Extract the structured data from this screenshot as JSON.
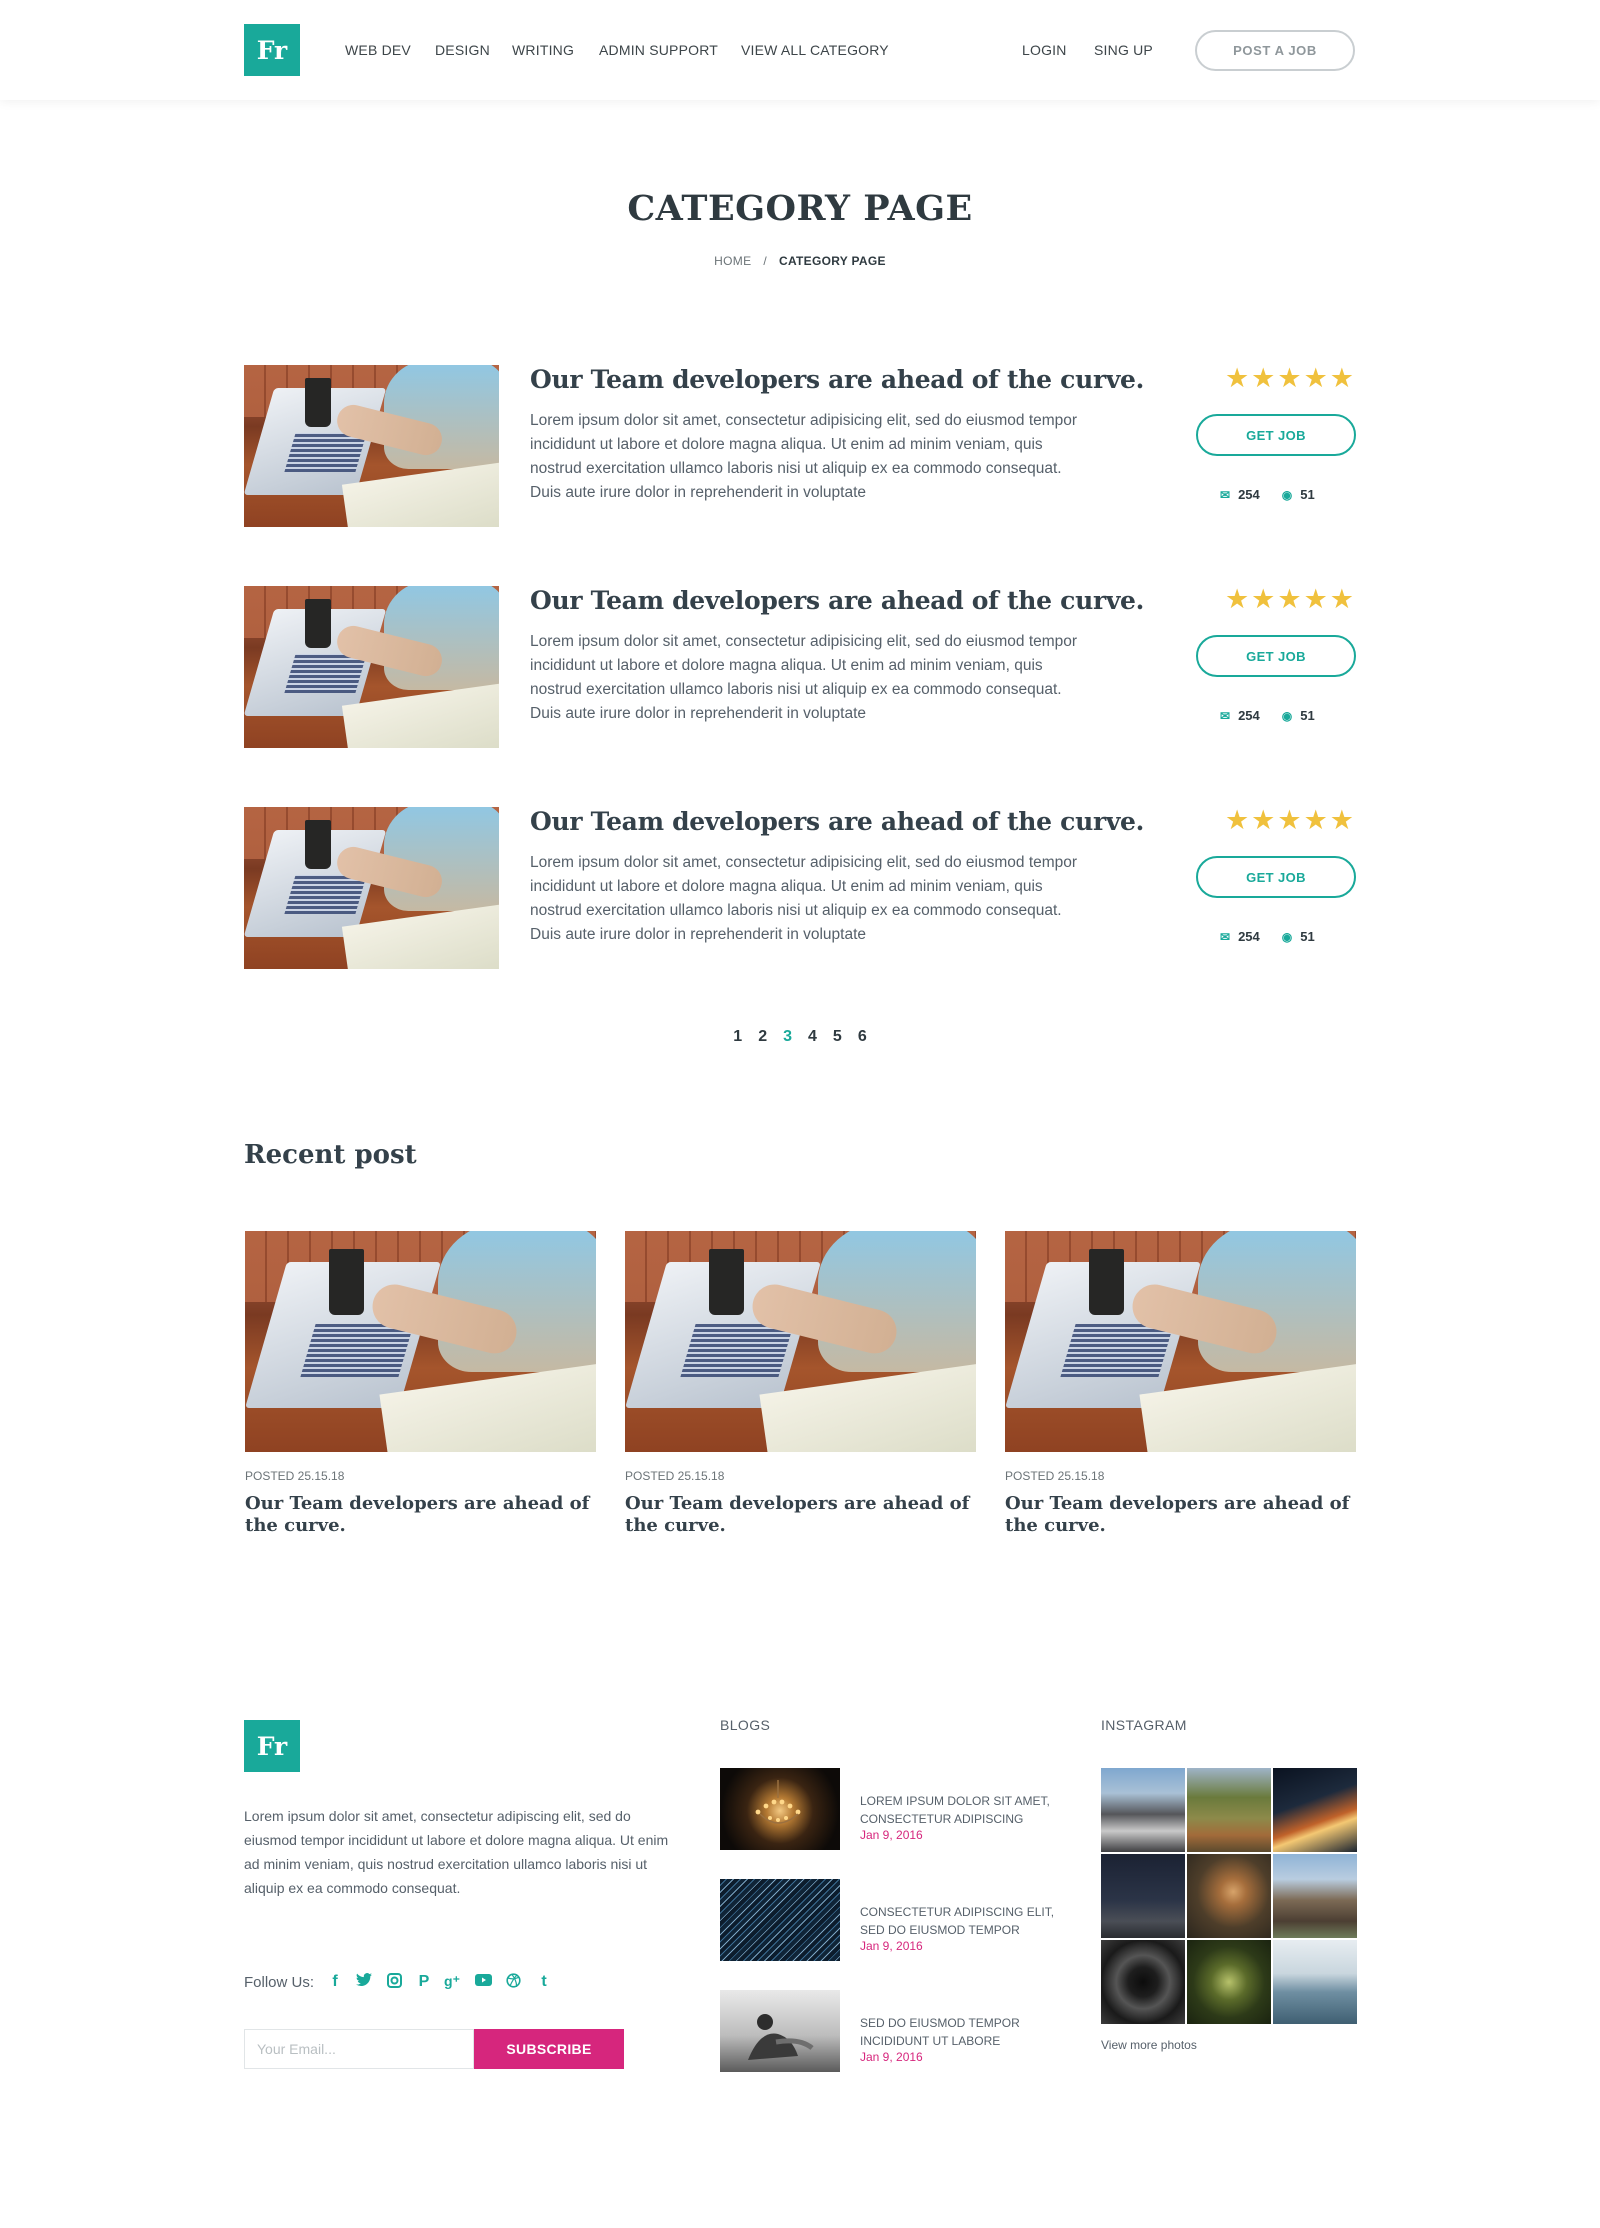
{
  "header": {
    "logo": "Fr",
    "nav": [
      "WEB DEV",
      "DESIGN",
      "WRITING",
      "ADMIN SUPPORT",
      "VIEW ALL CATEGORY"
    ],
    "login": "LOGIN",
    "signup": "SING UP",
    "post_job": "POST A JOB"
  },
  "hero": {
    "title": "CATEGORY PAGE",
    "breadcrumb": {
      "home": "HOME",
      "separator": "/",
      "current": "CATEGORY PAGE"
    }
  },
  "listings": [
    {
      "title": "Our Team developers are ahead of the curve.",
      "description": "Lorem ipsum dolor sit amet, consectetur adipisicing elit, sed do eiusmod tempor incididunt ut labore et dolore magna aliqua. Ut enim ad minim veniam, quis nostrud exercitation ullamco laboris nisi ut aliquip ex ea commodo consequat. Duis aute irure dolor in reprehenderit in voluptate",
      "rating": 5,
      "button": "GET JOB",
      "messages": "254",
      "views": "51"
    },
    {
      "title": "Our Team developers are ahead of the curve.",
      "description": "Lorem ipsum dolor sit amet, consectetur adipisicing elit, sed do eiusmod tempor incididunt ut labore et dolore magna aliqua. Ut enim ad minim veniam, quis nostrud exercitation ullamco laboris nisi ut aliquip ex ea commodo consequat. Duis aute irure dolor in reprehenderit in voluptate",
      "rating": 5,
      "button": "GET JOB",
      "messages": "254",
      "views": "51"
    },
    {
      "title": "Our Team developers are ahead of the curve.",
      "description": "Lorem ipsum dolor sit amet, consectetur adipisicing elit, sed do eiusmod tempor incididunt ut labore et dolore magna aliqua. Ut enim ad minim veniam, quis nostrud exercitation ullamco laboris nisi ut aliquip ex ea commodo consequat. Duis aute irure dolor in reprehenderit in voluptate",
      "rating": 5,
      "button": "GET JOB",
      "messages": "254",
      "views": "51"
    }
  ],
  "pagination": {
    "pages": [
      "1",
      "2",
      "3",
      "4",
      "5",
      "6"
    ],
    "current": "3"
  },
  "recent": {
    "title": "Recent post",
    "posts": [
      {
        "date": "POSTED 25.15.18",
        "title": "Our Team developers are ahead of the curve."
      },
      {
        "date": "POSTED 25.15.18",
        "title": "Our Team developers are ahead of the curve."
      },
      {
        "date": "POSTED 25.15.18",
        "title": "Our Team developers are ahead of the curve."
      }
    ]
  },
  "footer": {
    "logo": "Fr",
    "about": "Lorem ipsum dolor sit amet, consectetur adipiscing elit, sed do eiusmod tempor incididunt ut labore et dolore magna aliqua. Ut enim ad minim veniam, quis nostrud exercitation ullamco laboris nisi ut aliquip ex ea commodo consequat.",
    "follow": "Follow Us:",
    "social": [
      "facebook-icon",
      "twitter-icon",
      "instagram-icon",
      "pinterest-icon",
      "google-plus-icon",
      "youtube-icon",
      "dribbble-icon",
      "tumblr-icon"
    ],
    "email_placeholder": "Your Email...",
    "subscribe": "SUBSCRIBE",
    "blogs_title": "BLOGS",
    "blogs": [
      {
        "title": "LOREM IPSUM DOLOR SIT AMET, CONSECTETUR ADIPISCING",
        "date": "Jan 9, 2016"
      },
      {
        "title": "CONSECTETUR ADIPISCING ELIT, SED DO EIUSMOD TEMPOR",
        "date": "Jan 9, 2016"
      },
      {
        "title": "SED DO EIUSMOD TEMPOR INCIDIDUNT UT LABORE",
        "date": "Jan 9, 2016"
      }
    ],
    "instagram_title": "INSTAGRAM",
    "more_photos": "View more photos"
  },
  "colors": {
    "accent": "#19a99a",
    "pink": "#d6267d",
    "star": "#f0c13d"
  }
}
